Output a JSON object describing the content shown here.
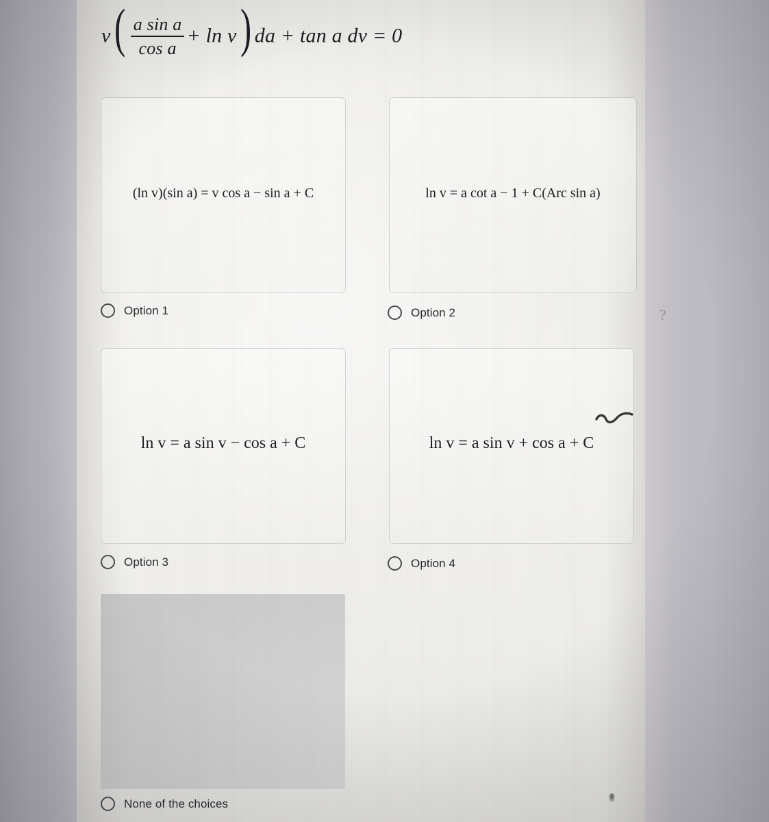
{
  "question": {
    "equation_plain": "v( a sin a / cos a + ln v ) da + tan a dv = 0",
    "lead_variable": "v",
    "numerator": "a sin a",
    "denominator": "cos a",
    "inner_term": "+ ln v",
    "tail": "da + tan a dv = 0"
  },
  "options": [
    {
      "id": "option-1",
      "formula": "(ln v)(sin a) = v cos a − sin a + C",
      "label": "Option 1",
      "selected": false
    },
    {
      "id": "option-2",
      "formula": "ln v = a cot a − 1 + C(Arc sin a)",
      "label": "Option 2",
      "selected": false
    },
    {
      "id": "option-3",
      "formula": "ln v = a sin v − cos a + C",
      "label": "Option 3",
      "selected": false
    },
    {
      "id": "option-4",
      "formula": "ln v = a sin v + cos a + C",
      "label": "Option 4",
      "selected": false
    }
  ],
  "none_choice": {
    "id": "none-of-the-choices",
    "label": "None of the choices",
    "selected": false
  },
  "colors": {
    "paper": "#f2f1ed",
    "text": "#1d1d23",
    "radio_outline": "#4a4a50",
    "card_border": "#969698",
    "side_band": "#b6b4ba",
    "blank_card": "#b8b8bc"
  }
}
